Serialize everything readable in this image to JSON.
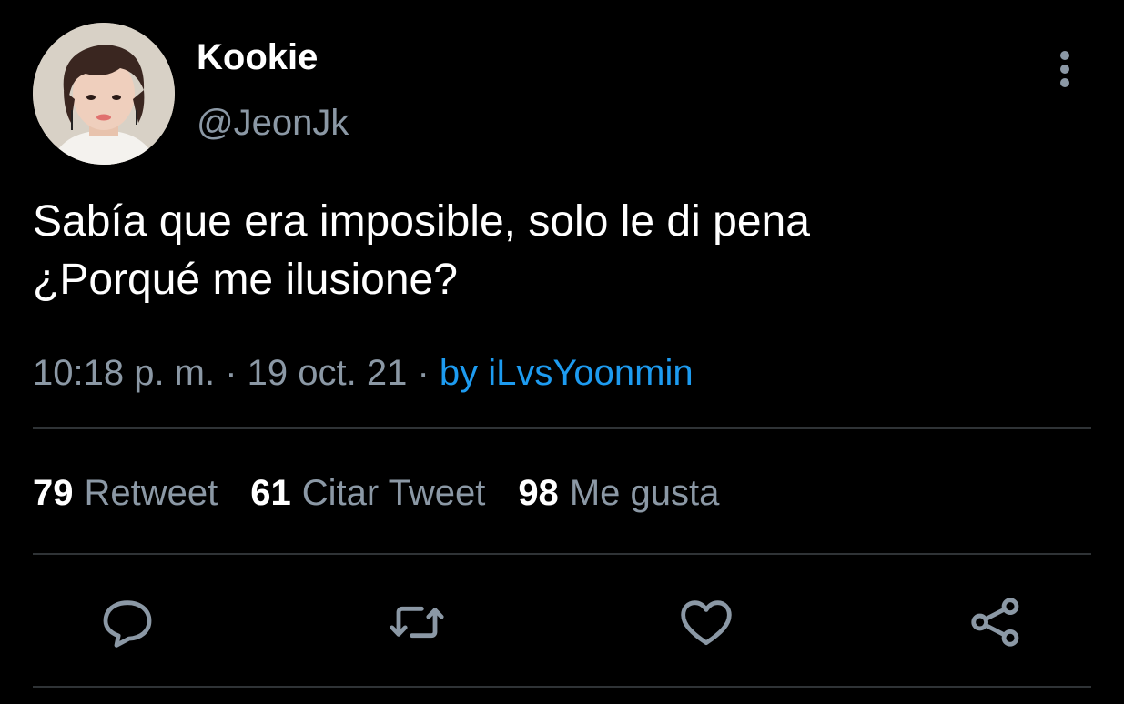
{
  "tweet": {
    "display_name": "Kookie",
    "handle": "@JeonJk",
    "text_lines": [
      "Sabía que era imposible, solo le di pena",
      "¿Porqué me ilusione?"
    ],
    "time": "10:18 p. m.",
    "separator": " · ",
    "date": "19 oct. 21",
    "source": "by iLvsYoonmin"
  },
  "stats": {
    "retweets": {
      "count": "79",
      "label": "Retweet"
    },
    "quotes": {
      "count": "61",
      "label": "Citar Tweet"
    },
    "likes": {
      "count": "98",
      "label": "Me gusta"
    }
  },
  "icons": {
    "avatar": "profile-photo",
    "more": "vertical-ellipsis-icon",
    "reply": "reply-icon",
    "retweet": "retweet-icon",
    "like": "heart-icon",
    "share": "share-icon"
  },
  "colors": {
    "background": "#000000",
    "primary_text": "#ffffff",
    "secondary_text": "#8b98a5",
    "link": "#1d9bf0",
    "divider": "#2f3336"
  }
}
